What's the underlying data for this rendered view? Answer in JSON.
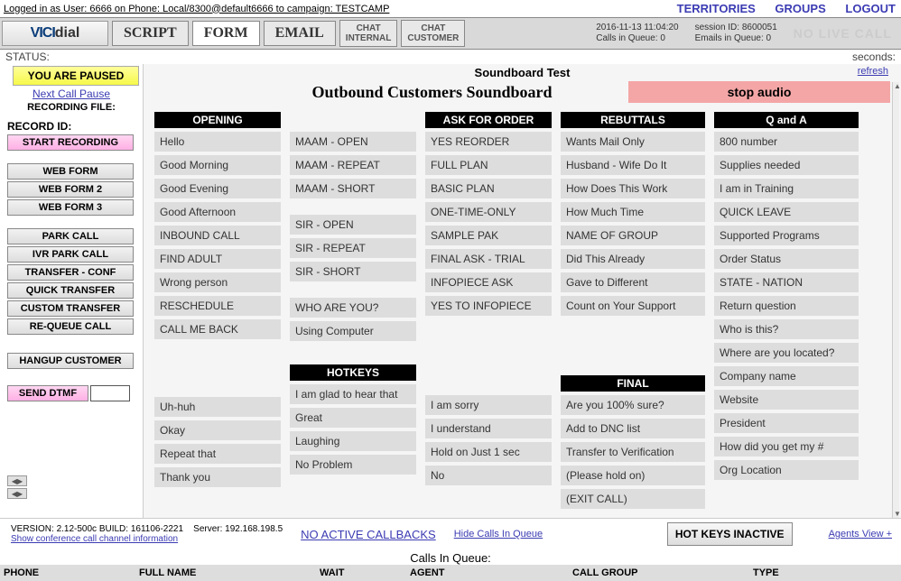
{
  "header": {
    "logged_in_text": "Logged in as User: 6666 on Phone: Local/8300@default6666 to campaign: TESTCAMP",
    "links": {
      "territories": "TERRITORIES",
      "groups": "GROUPS",
      "logout": "LOGOUT"
    },
    "logo_left": "VICI",
    "logo_right": "dial",
    "tabs": {
      "script": "SCRIPT",
      "form": "FORM",
      "email": "EMAIL",
      "chat_internal_l1": "CHAT",
      "chat_internal_l2": "INTERNAL",
      "chat_customer_l1": "CHAT",
      "chat_customer_l2": "CUSTOMER"
    },
    "info": {
      "datetime": "2016-11-13 11:04:20",
      "queue": "Calls in Queue: 0",
      "session": "session ID: 8600051",
      "emails": "Emails in Queue: 0",
      "nolive": "NO LIVE CALL"
    },
    "status_label": "STATUS:",
    "seconds_label": "seconds:"
  },
  "sidebar": {
    "paused": "YOU ARE PAUSED",
    "next_call": "Next Call Pause",
    "recording_file": "RECORDING FILE:",
    "record_id": "RECORD ID:",
    "start_recording": "START RECORDING",
    "web_form": "WEB FORM",
    "web_form_2": "WEB FORM 2",
    "web_form_3": "WEB FORM 3",
    "park_call": "PARK CALL",
    "ivr_park": "IVR PARK CALL",
    "transfer_conf": "TRANSFER - CONF",
    "quick_transfer": "QUICK TRANSFER",
    "custom_transfer": "CUSTOM TRANSFER",
    "requeue": "RE-QUEUE CALL",
    "hangup": "HANGUP CUSTOMER",
    "send_dtmf": "SEND DTMF"
  },
  "soundboard": {
    "title_small": "Soundboard Test",
    "title": "Outbound Customers Soundboard",
    "stop_audio": "stop audio",
    "refresh": "refresh",
    "headers": {
      "opening": "OPENING",
      "ask": "ASK FOR ORDER",
      "rebuttals": "REBUTTALS",
      "qa": "Q and A",
      "hotkeys": "HOTKEYS",
      "final": "FINAL"
    },
    "col1a": [
      "Hello",
      "Good Morning",
      "Good Evening",
      "Good Afternoon",
      "INBOUND CALL",
      "FIND ADULT",
      "Wrong person",
      "RESCHEDULE",
      "CALL ME BACK"
    ],
    "col2a": [
      "MAAM - OPEN",
      "MAAM - REPEAT",
      "MAAM - SHORT"
    ],
    "col2b": [
      "SIR - OPEN",
      "SIR - REPEAT",
      "SIR - SHORT"
    ],
    "col2c": [
      "WHO ARE YOU?",
      "Using Computer"
    ],
    "col3": [
      "YES REORDER",
      "FULL PLAN",
      "BASIC PLAN",
      "ONE-TIME-ONLY",
      "SAMPLE PAK",
      "FINAL ASK - TRIAL",
      "INFOPIECE ASK",
      "YES TO INFOPIECE"
    ],
    "col4": [
      "Wants Mail Only",
      "Husband - Wife Do It",
      "How Does This Work",
      "How Much Time",
      "NAME OF GROUP",
      "Did This Already",
      "Gave to Different",
      "Count on Your Support"
    ],
    "col5": [
      "800 number",
      "Supplies needed",
      "I am in Training",
      "QUICK LEAVE",
      "Supported Programs",
      "Order Status",
      "STATE - NATION",
      "Return question",
      "Who is this?",
      "Where are you located?",
      "Company name",
      "Website",
      "President",
      "How did you get my #",
      "Org Location"
    ],
    "hk1": [
      "Uh-huh",
      "Okay",
      "Repeat that",
      "Thank you"
    ],
    "hk2": [
      "I am glad to hear that",
      "Great",
      "Laughing",
      "No Problem"
    ],
    "hk3": [
      "I am sorry",
      "I understand",
      "Hold on Just 1 sec",
      "No"
    ],
    "final": [
      "Are you 100% sure?",
      "Add to DNC list",
      "Transfer to Verification",
      "(Please hold on)",
      "(EXIT CALL)"
    ]
  },
  "footer": {
    "version": "VERSION: 2.12-500c   BUILD: 161106-2221",
    "server": "Server: 192.168.198.5",
    "conf_info": "Show conference call channel information",
    "no_callbacks": "NO ACTIVE CALLBACKS",
    "hide_queue": "Hide Calls In Queue",
    "hotkeys": "HOT KEYS INACTIVE",
    "agents_view": "Agents View +",
    "queue_title": "Calls In Queue:",
    "cols": {
      "phone": "PHONE",
      "full_name": "FULL NAME",
      "wait": "WAIT",
      "agent": "AGENT",
      "call_group": "CALL GROUP",
      "type": "TYPE"
    }
  }
}
